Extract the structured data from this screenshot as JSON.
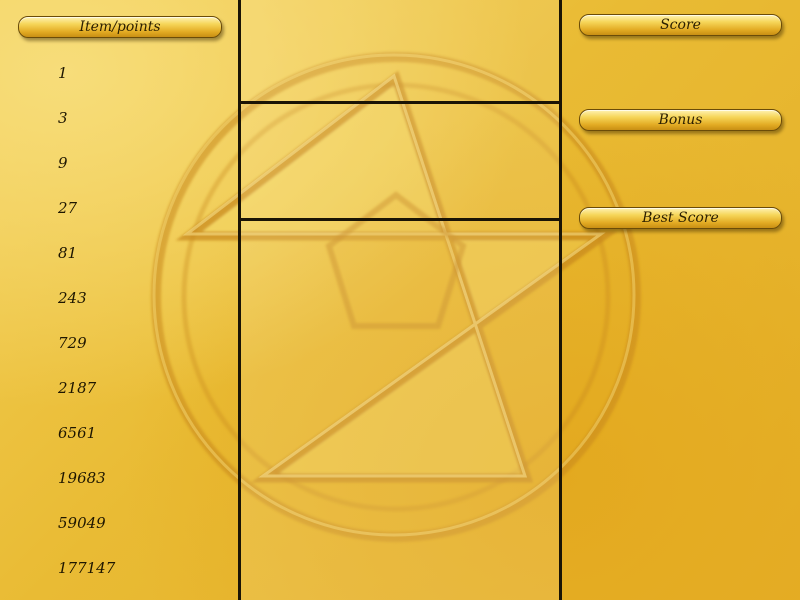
{
  "hud": {
    "items_header": "Item/points",
    "score_label": "Score",
    "bonus_label": "Bonus",
    "best_score_label": "Best Score"
  },
  "points": [
    "1",
    "3",
    "9",
    "27",
    "81",
    "243",
    "729",
    "2187",
    "6561",
    "19683",
    "59049",
    "177147"
  ],
  "background": {
    "emblem": "pentagram-emblem"
  },
  "colors": {
    "background": "#e9b92f",
    "emblem_groove": "#c8881a",
    "frame_line": "#1a1405"
  }
}
